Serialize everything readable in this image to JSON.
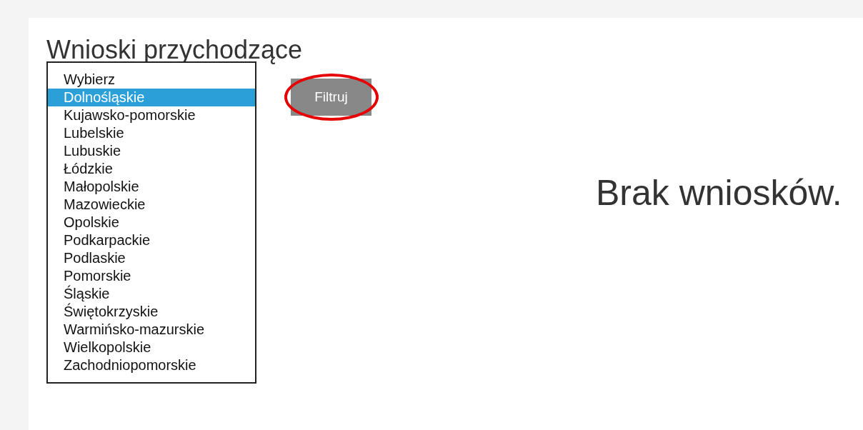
{
  "title": "Wnioski przychodzące",
  "region_list": {
    "options": [
      {
        "label": "Wybierz",
        "selected": false
      },
      {
        "label": "Dolnośląskie",
        "selected": true
      },
      {
        "label": "Kujawsko-pomorskie",
        "selected": false
      },
      {
        "label": "Lubelskie",
        "selected": false
      },
      {
        "label": "Lubuskie",
        "selected": false
      },
      {
        "label": "Łódzkie",
        "selected": false
      },
      {
        "label": "Małopolskie",
        "selected": false
      },
      {
        "label": "Mazowieckie",
        "selected": false
      },
      {
        "label": "Opolskie",
        "selected": false
      },
      {
        "label": "Podkarpackie",
        "selected": false
      },
      {
        "label": "Podlaskie",
        "selected": false
      },
      {
        "label": "Pomorskie",
        "selected": false
      },
      {
        "label": "Śląskie",
        "selected": false
      },
      {
        "label": "Świętokrzyskie",
        "selected": false
      },
      {
        "label": "Warmińsko-mazurskie",
        "selected": false
      },
      {
        "label": "Wielkopolskie",
        "selected": false
      },
      {
        "label": "Zachodniopomorskie",
        "selected": false
      }
    ]
  },
  "filter_button": {
    "label": "Filtruj",
    "highlighted": true
  },
  "empty_message": "Brak wniosków."
}
